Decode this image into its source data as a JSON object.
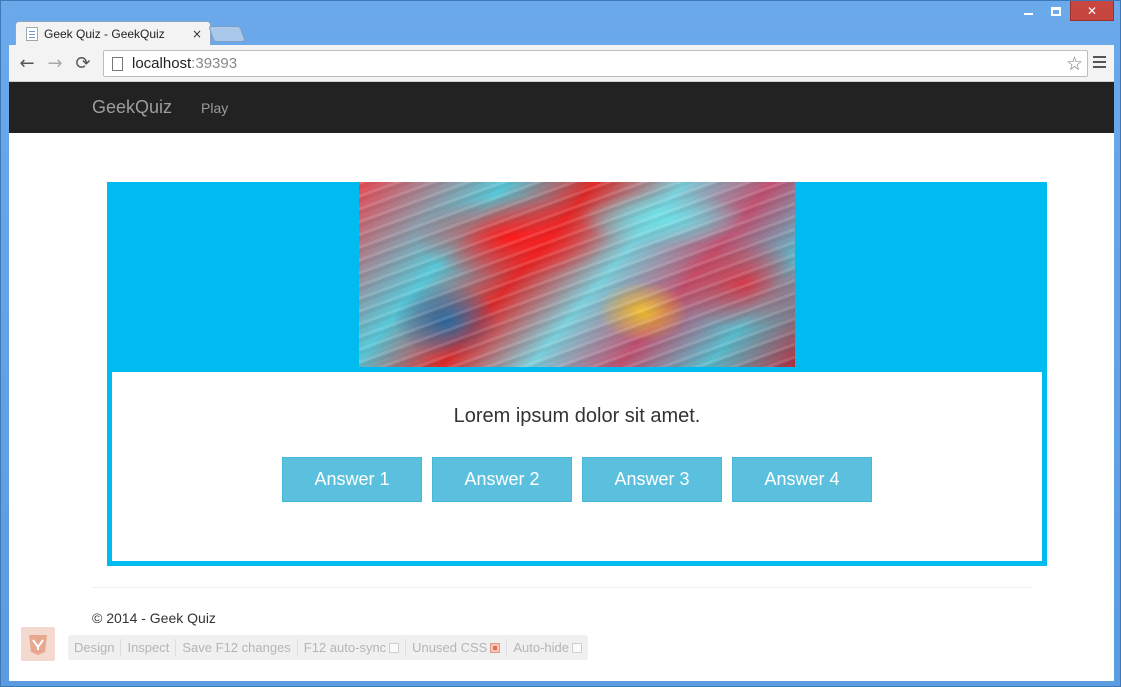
{
  "browser": {
    "tab_title": "Geek Quiz - GeekQuiz",
    "tab_close": "×",
    "address_host": "localhost",
    "address_port": ":39393",
    "back_icon": "←",
    "forward_icon": "→",
    "reload_icon": "⟳",
    "star_icon": "☆"
  },
  "window_controls": {
    "minimize": "",
    "maximize": "",
    "close": "✕"
  },
  "navbar": {
    "brand": "GeekQuiz",
    "links": [
      "Play"
    ],
    "background": "#222222"
  },
  "quiz": {
    "question": "Lorem ipsum dolor sit amet.",
    "answers": [
      "Answer 1",
      "Answer 2",
      "Answer 3",
      "Answer 4"
    ],
    "card_color": "#00bbf0",
    "button_color": "#5bc0de"
  },
  "footer": {
    "text": "© 2014 - Geek Quiz"
  },
  "browser_link_toolbar": {
    "items": [
      {
        "label": "Design",
        "checkbox": null
      },
      {
        "label": "Inspect",
        "checkbox": null
      },
      {
        "label": "Save F12 changes",
        "checkbox": null
      },
      {
        "label": "F12 auto-sync",
        "checkbox": false
      },
      {
        "label": "Unused CSS",
        "checkbox": true
      },
      {
        "label": "Auto-hide",
        "checkbox": false
      }
    ]
  }
}
